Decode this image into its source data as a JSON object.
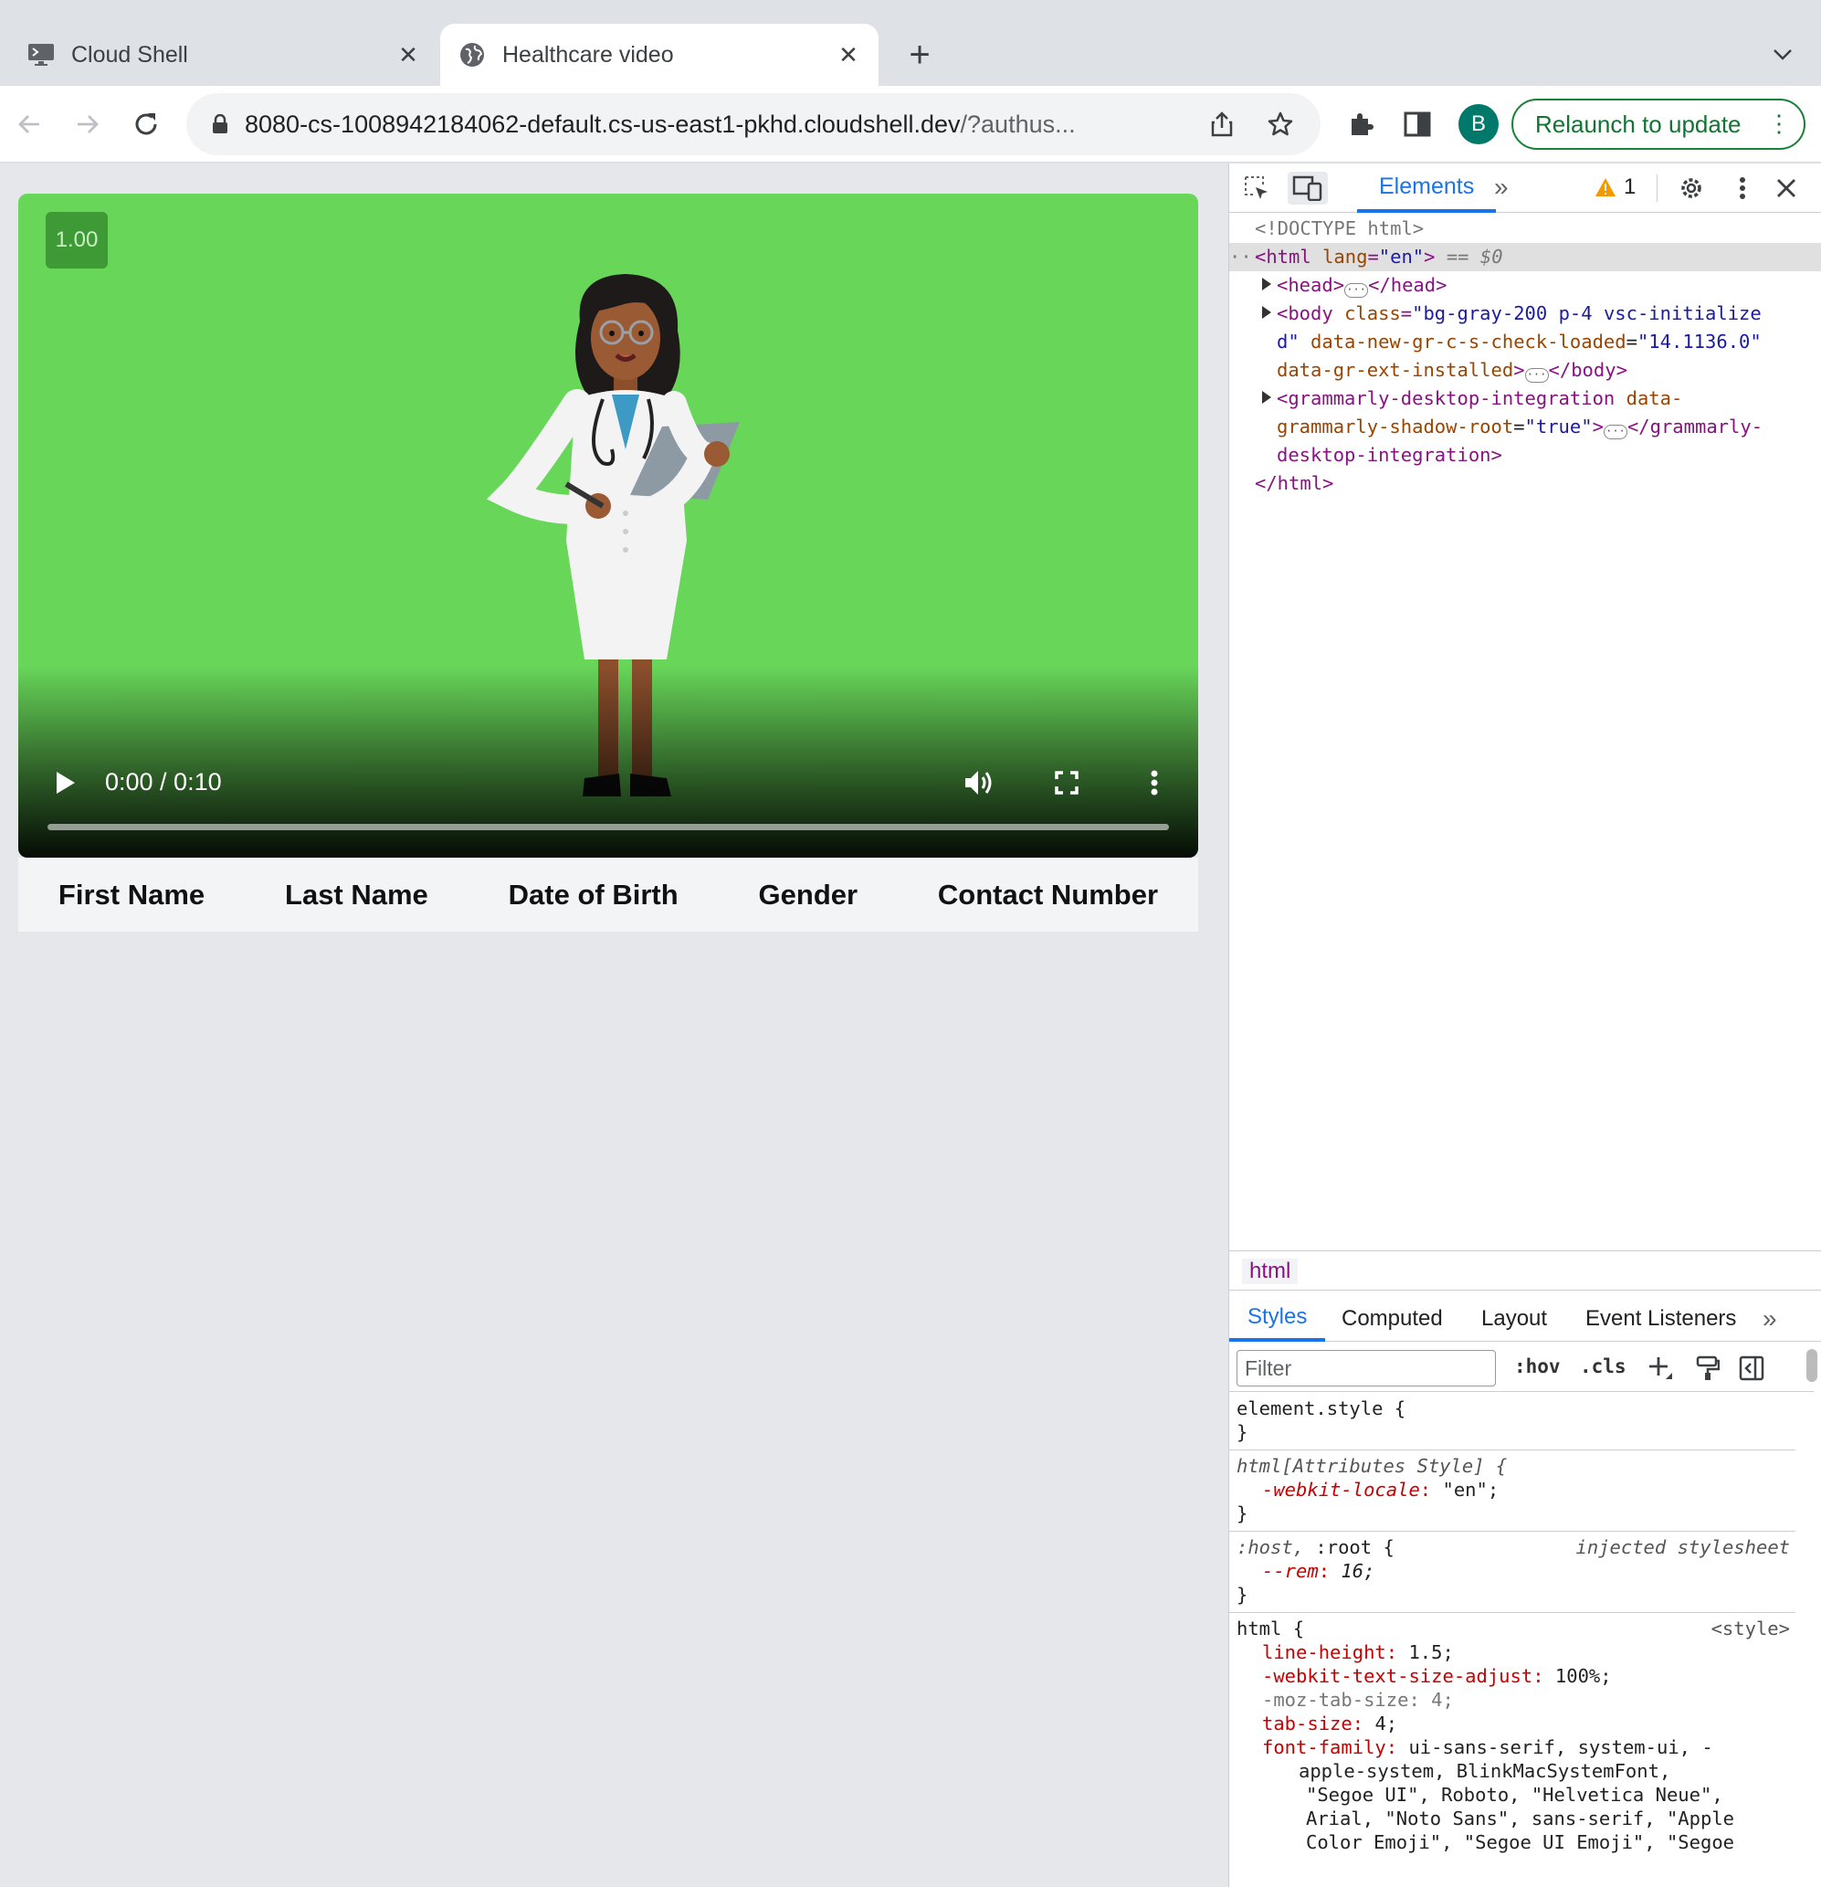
{
  "browser": {
    "tabs": [
      {
        "title": "Cloud Shell",
        "active": false
      },
      {
        "title": "Healthcare video",
        "active": true
      }
    ],
    "url_host": "8080-cs-1008942184062-default.cs-us-east1-pkhd.cloudshell.dev",
    "url_path": "/?authus...",
    "profile_initial": "B",
    "relaunch_label": "Relaunch to update"
  },
  "page": {
    "video": {
      "speed_badge": "1.00",
      "time": "0:00 / 0:10",
      "progress_fraction": 0
    },
    "table_headers": [
      "First Name",
      "Last Name",
      "Date of Birth",
      "Gender",
      "Contact Number"
    ]
  },
  "devtools": {
    "active_tab": "Elements",
    "warning_count": "1",
    "dom": {
      "doctype": "<!DOCTYPE html>",
      "html_open_tag": "html",
      "html_lang_attr": "lang",
      "html_lang_val": "\"en\"",
      "selected_marker": "== $0",
      "head_tag": "head",
      "body_line1_tag": "body",
      "body_line1_attr": "class",
      "body_line1_val": "\"bg-gray-200 p-4 vsc-initialize",
      "body_line2_val": "d\"",
      "body_line2_attr": "data-new-gr-c-s-check-loaded",
      "body_line2_val2": "\"14.1136.0\"",
      "body_line3_attr": "data-gr-ext-installed",
      "gram_line1_tag": "grammarly-desktop-integration",
      "gram_line1_attr": "data-",
      "gram_line2_attr": "grammarly-shadow-root",
      "gram_line2_val": "\"true\"",
      "gram_line2_close": "</grammarly-",
      "gram_line3": "desktop-integration>",
      "html_close": "</html>"
    },
    "breadcrumb": "html",
    "subtabs": [
      "Styles",
      "Computed",
      "Layout",
      "Event Listeners"
    ],
    "filter_placeholder": "Filter",
    "hov_label": ":hov",
    "cls_label": ".cls",
    "styles": {
      "r1_selector": "element.style {",
      "close": "}",
      "r2_selector": "html[Attributes Style] {",
      "r2_prop": "-webkit-locale",
      "r2_val": "\"en\";",
      "r3_selector_a": ":host,",
      "r3_selector_b": ":root {",
      "r3_origin": "injected stylesheet",
      "r3_prop": "--rem",
      "r3_val": "16;",
      "r4_selector": "html {",
      "r4_origin": "<style>",
      "r4_props": [
        {
          "name": "line-height",
          "value": "1.5;"
        },
        {
          "name": "-webkit-text-size-adjust",
          "value": "100%;"
        },
        {
          "name": "-moz-tab-size",
          "value": "4;"
        },
        {
          "name": "tab-size",
          "value": "4;"
        },
        {
          "name": "font-family",
          "value": "ui-sans-serif, system-ui, -"
        }
      ],
      "r4_font_wrap": [
        "apple-system, BlinkMacSystemFont,",
        "\"Segoe UI\", Roboto, \"Helvetica Neue\",",
        "Arial, \"Noto Sans\", sans-serif, \"Apple",
        "Color Emoji\", \"Segoe UI Emoji\", \"Segoe"
      ]
    }
  }
}
